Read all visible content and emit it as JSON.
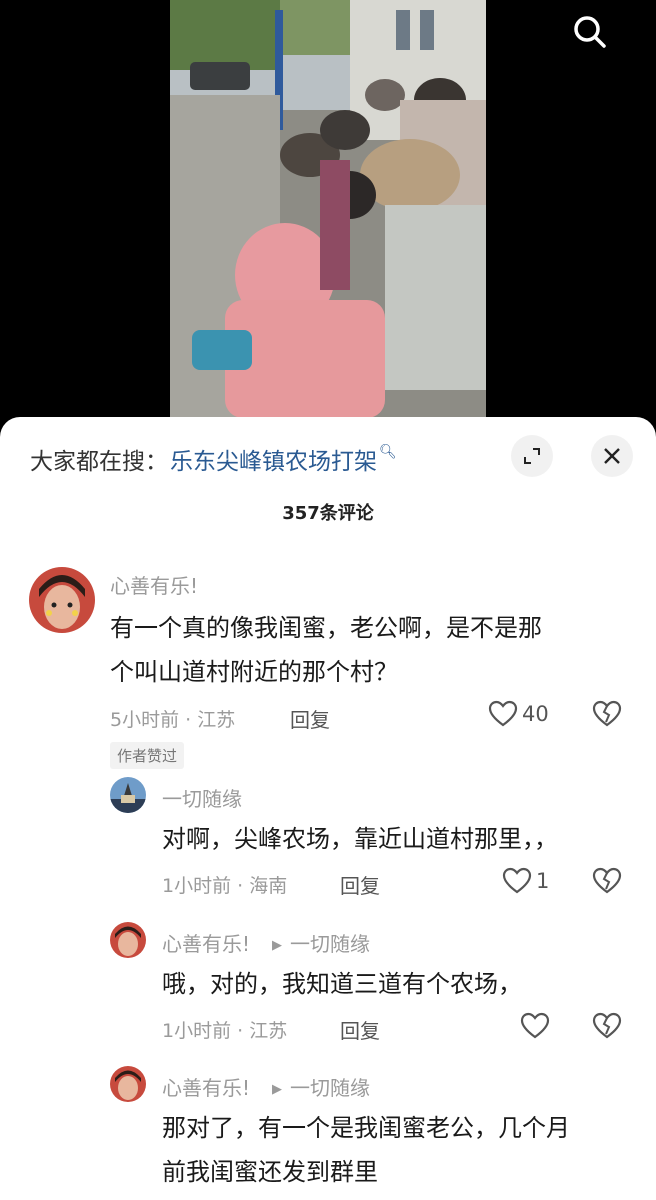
{
  "trend": {
    "prefix": "大家都在搜：",
    "query": "乐东尖峰镇农场打架"
  },
  "comment_count": "357条评论",
  "comments": [
    {
      "user": "心善有乐!",
      "lines": [
        "有一个真的像我闺蜜，老公啊，是不是那",
        "个叫山道村附近的那个村？"
      ],
      "meta": "5小时前 · 江苏",
      "reply": "回复",
      "likes": "40",
      "badge": "作者赞过"
    },
    {
      "user": "一切随缘",
      "lines": [
        "对啊，尖峰农场，靠近山道村那里，，"
      ],
      "meta": "1小时前 · 海南",
      "reply": "回复",
      "likes": "1"
    },
    {
      "user": "心善有乐!",
      "reply_to": "一切随缘",
      "lines": [
        "哦，对的，我知道三道有个农场，"
      ],
      "meta": "1小时前 · 江苏",
      "reply": "回复",
      "likes": ""
    },
    {
      "user": "心善有乐!",
      "reply_to": "一切随缘",
      "lines": [
        "那对了，有一个是我闺蜜老公，几个月",
        "前我闺蜜还发到群里"
      ]
    }
  ],
  "colors": {
    "link": "#2a5a92",
    "muted": "#9a9a9a",
    "text": "#1a1a1a",
    "sheet": "#ffffff"
  }
}
